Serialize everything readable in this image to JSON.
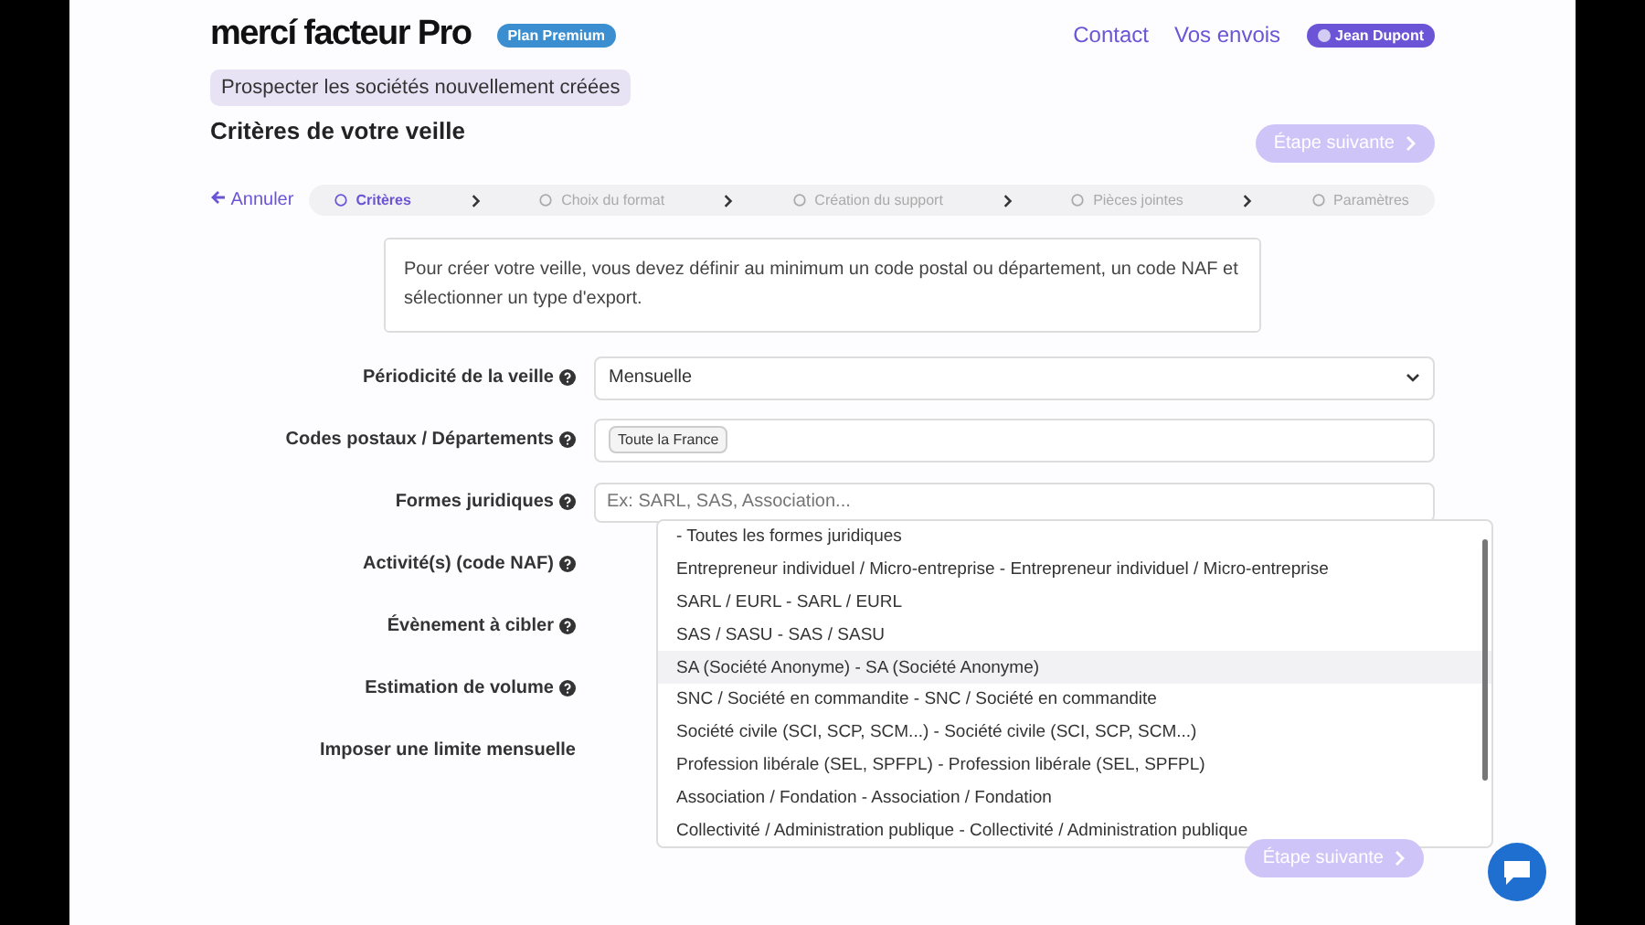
{
  "header": {
    "logo": "mercí facteur Pro",
    "plan_badge": "Plan Premium",
    "links": [
      "Contact",
      "Vos envois"
    ],
    "user": "Jean Dupont"
  },
  "breadcrumb": "Prospecter les sociétés nouvellement créées",
  "title": "Critères de votre veille",
  "next_button": {
    "label": "Étape suivante",
    "disabled": true
  },
  "cancel": "Annuler",
  "steps": [
    {
      "label": "Critères",
      "selected": true
    },
    {
      "label": "Choix du format",
      "selected": false
    },
    {
      "label": "Création du support",
      "selected": false
    },
    {
      "label": "Pièces jointes",
      "selected": false
    },
    {
      "label": "Paramètres",
      "selected": false
    }
  ],
  "info": "Pour créer votre veille, vous devez définir au minimum un code postal ou département, un code NAF et sélectionner un type d'export.",
  "fields": [
    {
      "label": "Périodicité de la veille",
      "help": true,
      "kind": "select",
      "value": "Mensuelle"
    },
    {
      "label": "Codes postaux / Départements",
      "help": true,
      "kind": "tags",
      "tags": [
        "Toute la France"
      ]
    },
    {
      "label": "Formes juridiques",
      "help": true,
      "kind": "search",
      "placeholder": "Ex: SARL, SAS, Association..."
    },
    {
      "label": "Activité(s) (code NAF)",
      "help": true,
      "kind": "hidden"
    },
    {
      "label": "Évènement à cibler",
      "help": true,
      "kind": "hidden"
    },
    {
      "label": "Estimation de volume",
      "help": true,
      "kind": "hidden"
    },
    {
      "label": "Imposer une limite mensuelle",
      "help": false,
      "kind": "hidden"
    }
  ],
  "dropdown": {
    "options": [
      {
        "label": "- Toutes les formes juridiques",
        "selected": false
      },
      {
        "label": "Entrepreneur individuel / Micro-entreprise - Entrepreneur individuel / Micro-entreprise",
        "selected": false
      },
      {
        "label": "SARL / EURL - SARL / EURL",
        "selected": false
      },
      {
        "label": "SAS / SASU - SAS / SASU",
        "selected": false
      },
      {
        "label": "SA (Société Anonyme) - SA (Société Anonyme)",
        "selected": true
      },
      {
        "label": "SNC / Société en commandite - SNC / Société en commandite",
        "selected": false
      },
      {
        "label": "Société civile (SCI, SCP, SCM...) - Société civile (SCI, SCP, SCM...)",
        "selected": false
      },
      {
        "label": "Profession libérale (SEL, SPFPL) - Profession libérale (SEL, SPFPL)",
        "selected": false
      },
      {
        "label": "Association / Fondation - Association / Fondation",
        "selected": false
      },
      {
        "label": "Collectivité / Administration publique - Collectivité / Administration publique",
        "selected": false
      }
    ]
  },
  "bottom_button": {
    "label": "Étape suivante",
    "disabled": true
  }
}
